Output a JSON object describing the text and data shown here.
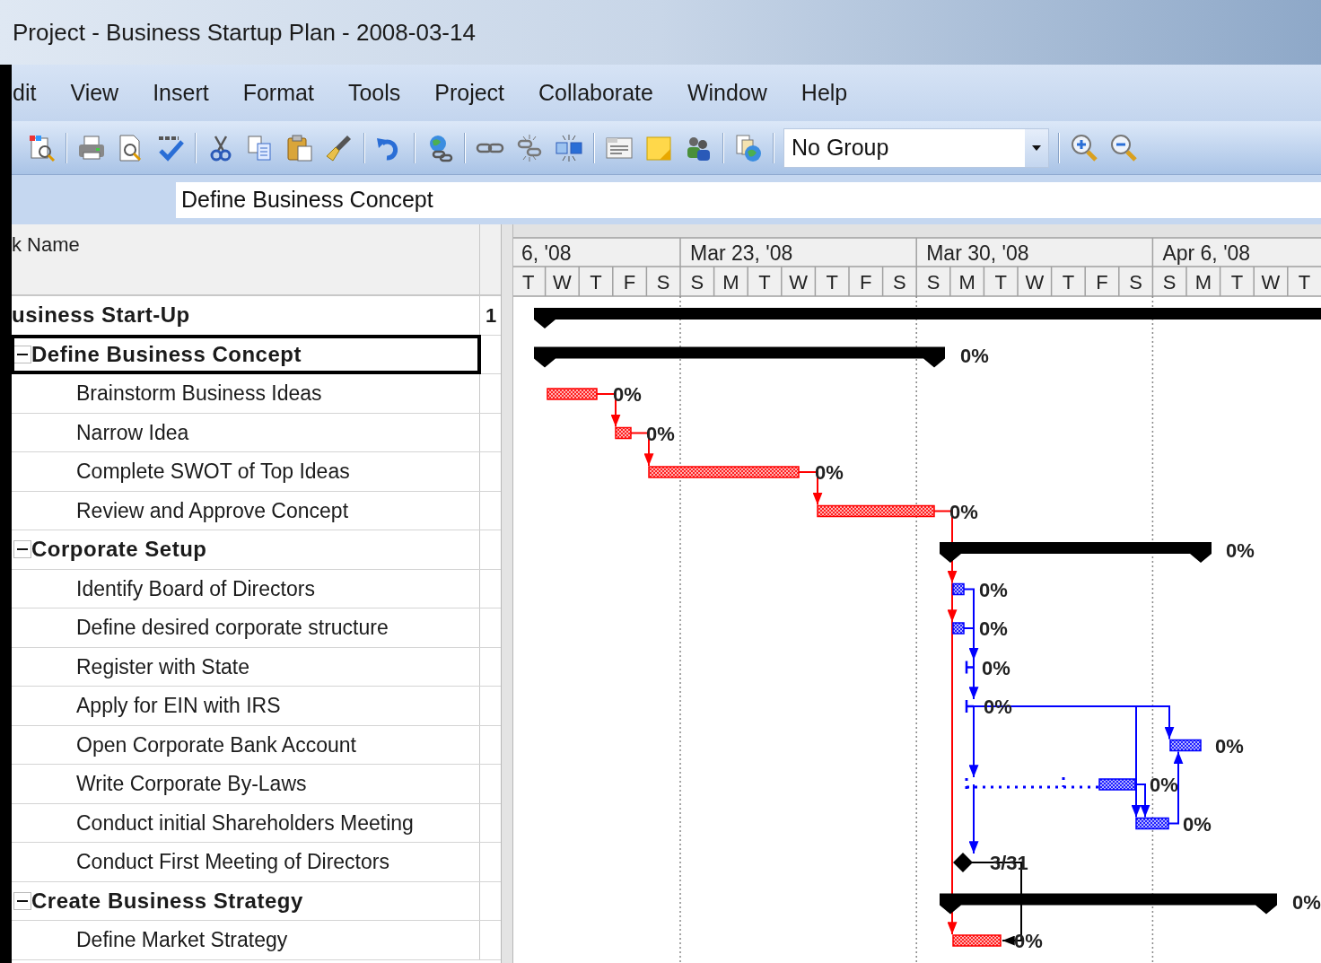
{
  "window": {
    "title": "Project - Business Startup Plan - 2008-03-14"
  },
  "menu": [
    {
      "label": "dit"
    },
    {
      "label": "View"
    },
    {
      "label": "Insert"
    },
    {
      "label": "Format"
    },
    {
      "label": "Tools"
    },
    {
      "label": "Project"
    },
    {
      "label": "Collaborate"
    },
    {
      "label": "Window"
    },
    {
      "label": "Help"
    }
  ],
  "toolbar": {
    "group_dropdown": {
      "value": "No Group"
    }
  },
  "entry_bar": {
    "value": "Define Business Concept"
  },
  "table": {
    "column_header": "k Name"
  },
  "timescale": {
    "weeks": [
      "6, '08",
      "Mar 23, '08",
      "Mar 30, '08",
      "Apr 6, '08"
    ],
    "days": [
      "T",
      "W",
      "T",
      "F",
      "S",
      "S",
      "M",
      "T",
      "W",
      "T",
      "F",
      "S",
      "S",
      "M",
      "T",
      "W",
      "T",
      "F",
      "S",
      "S",
      "M",
      "T",
      "W",
      "T"
    ]
  },
  "tasks": [
    {
      "name": "usiness Start-Up",
      "column_2": "1",
      "selected": false,
      "bar": {
        "kind": "summary"
      },
      "children": [
        {
          "name": "Define Business Concept",
          "selected": true,
          "expanded": true,
          "bar": {
            "kind": "summary",
            "label": "0%"
          },
          "children": [
            {
              "name": "Brainstorm Business Ideas",
              "selected": false,
              "bar": {
                "kind": "task",
                "critical": true,
                "label": "0%"
              }
            },
            {
              "name": "Narrow Idea",
              "selected": false,
              "bar": {
                "kind": "task",
                "critical": true,
                "label": "0%"
              }
            },
            {
              "name": "Complete SWOT of Top Ideas",
              "selected": false,
              "bar": {
                "kind": "task",
                "critical": true,
                "label": "0%"
              }
            },
            {
              "name": "Review and Approve Concept",
              "selected": false,
              "bar": {
                "kind": "task",
                "critical": true,
                "label": "0%"
              }
            }
          ]
        },
        {
          "name": "Corporate Setup",
          "selected": false,
          "expanded": true,
          "bar": {
            "kind": "summary",
            "label": "0%"
          },
          "children": [
            {
              "name": "Identify Board of Directors",
              "selected": false,
              "bar": {
                "kind": "task",
                "critical": false,
                "label": "0%"
              }
            },
            {
              "name": "Define desired corporate structure",
              "selected": false,
              "bar": {
                "kind": "task",
                "critical": false,
                "label": "0%"
              }
            },
            {
              "name": "Register with State",
              "selected": false,
              "bar": {
                "kind": "stub",
                "critical": false,
                "label": "0%"
              }
            },
            {
              "name": "Apply for EIN with IRS",
              "selected": false,
              "bar": {
                "kind": "stub",
                "critical": false,
                "label": "0%"
              }
            },
            {
              "name": "Open Corporate Bank Account",
              "selected": false,
              "bar": {
                "kind": "task",
                "critical": false,
                "label": "0%"
              }
            },
            {
              "name": "Write Corporate By-Laws",
              "selected": false,
              "bar": {
                "kind": "split",
                "critical": false,
                "label": "0%"
              }
            },
            {
              "name": "Conduct initial Shareholders Meeting",
              "selected": false,
              "bar": {
                "kind": "task",
                "critical": false,
                "label": "0%"
              }
            },
            {
              "name": "Conduct First Meeting of Directors",
              "selected": false,
              "bar": {
                "kind": "milestone",
                "critical": false,
                "label": "3/31"
              }
            }
          ]
        },
        {
          "name": "Create Business Strategy",
          "selected": false,
          "expanded": true,
          "bar": {
            "kind": "summary",
            "label": "0%"
          },
          "children": [
            {
              "name": "Define Market Strategy",
              "selected": false,
              "bar": {
                "kind": "task",
                "critical": true,
                "label": "0%"
              }
            }
          ]
        }
      ]
    }
  ]
}
